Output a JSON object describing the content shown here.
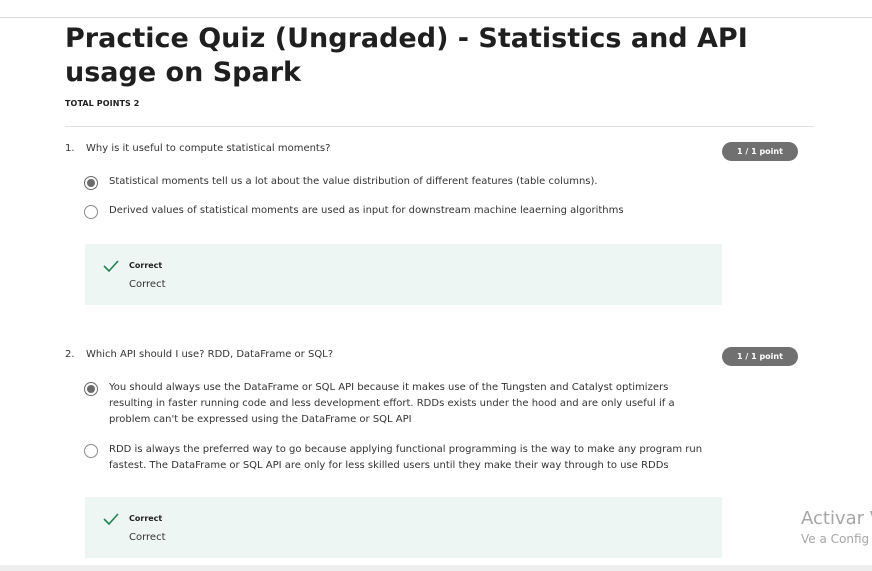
{
  "quiz": {
    "title": "Practice Quiz (Ungraded) - Statistics and API usage on Spark",
    "total_points": "TOTAL POINTS 2"
  },
  "questions": [
    {
      "number": "1.",
      "text": "Why is it useful to compute statistical moments?",
      "points": "1 / 1 point",
      "options": [
        {
          "text": "Statistical moments tell us a lot about the value distribution of different features (table columns).",
          "selected": true
        },
        {
          "text": "Derived values of statistical moments are used as input for downstream machine leaerning algorithms",
          "selected": false
        }
      ],
      "feedback": {
        "title": "Correct",
        "text": "Correct"
      }
    },
    {
      "number": "2.",
      "text": "Which API should I use? RDD, DataFrame or SQL?",
      "points": "1 / 1 point",
      "options": [
        {
          "text": "You should always use the DataFrame or SQL API because it makes use of the Tungsten and Catalyst optimizers resulting in faster running code and less development effort. RDDs exists under the hood and are only useful if a problem can't be expressed using the DataFrame or SQL API",
          "selected": true
        },
        {
          "text": "RDD is always the preferred way to go because applying functional programming is the way to make any program run fastest. The DataFrame or SQL API are only for less skilled users until they make their way through to use RDDs",
          "selected": false
        }
      ],
      "feedback": {
        "title": "Correct",
        "text": "Correct"
      }
    }
  ],
  "watermark": {
    "title": "Activar V",
    "subtitle": "Ve a Config"
  },
  "colors": {
    "badge": "#707070",
    "feedback_bg": "#eef6f3",
    "check": "#1f8354"
  },
  "icons": {
    "check": "check-icon",
    "radio_selected": "radio-selected-icon",
    "radio_unselected": "radio-unselected-icon"
  }
}
